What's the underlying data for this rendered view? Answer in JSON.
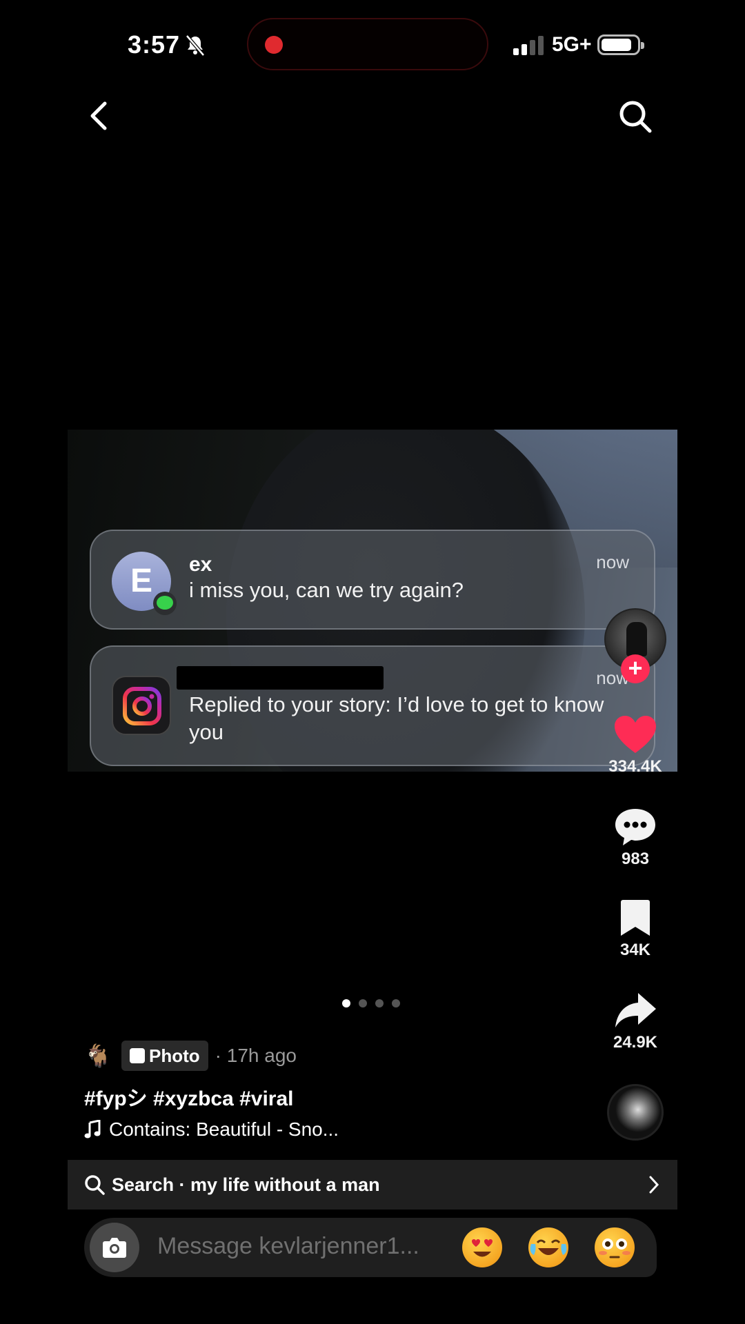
{
  "status_bar": {
    "time": "3:57",
    "network": "5G+"
  },
  "notifications": [
    {
      "avatar_letter": "E",
      "sender": "ex",
      "message": "i miss you, can we try again?",
      "time": "now"
    },
    {
      "app": "instagram-icon",
      "message": "Replied to your story: I’d love to get to know you",
      "time": "now"
    }
  ],
  "rail": {
    "likes": "334.4K",
    "comments": "983",
    "saves": "34K",
    "shares": "24.9K"
  },
  "carousel": {
    "pages": 4,
    "active": 0
  },
  "caption": {
    "emoji": "🐐",
    "type_label": "Photo",
    "time_ago": "· 17h ago",
    "hashtags": "#fypシ #xyzbca #viral",
    "sound": "Contains: Beautiful - Sno..."
  },
  "search_bar": {
    "text": "Search · my life without a man"
  },
  "message_bar": {
    "placeholder": "Message kevlarjenner1..."
  },
  "colors": {
    "like": "#fe2c55",
    "follow": "#fe2c55",
    "background": "#000000"
  }
}
